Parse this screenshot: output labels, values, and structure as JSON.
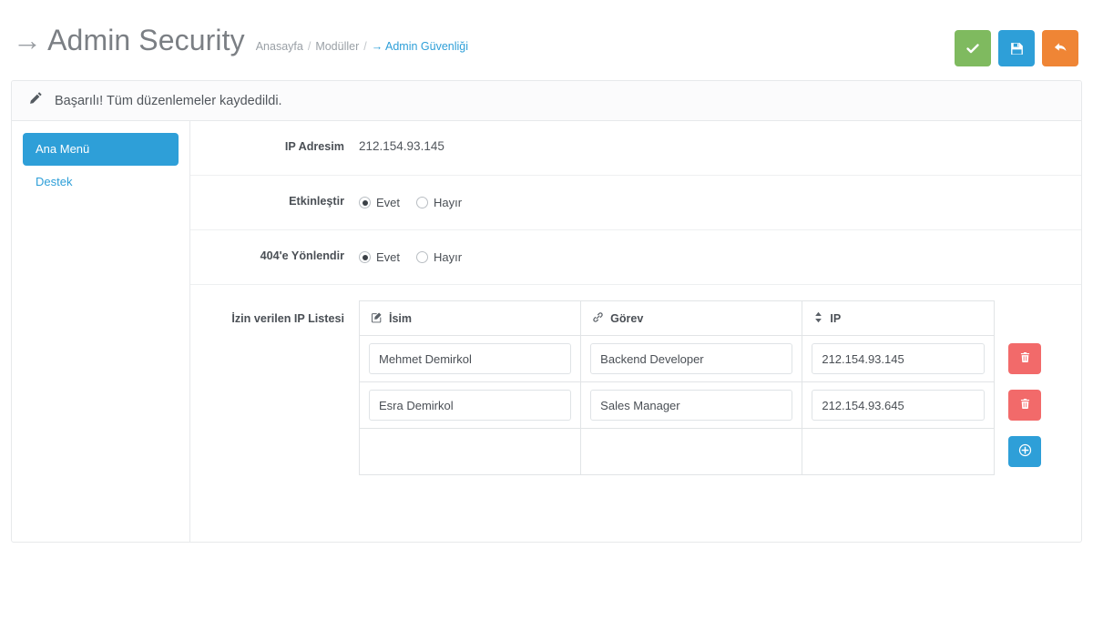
{
  "header": {
    "arrow_glyph": "→",
    "title": "Admin Security",
    "breadcrumb": {
      "home": "Anasayfa",
      "section": "Modüller",
      "current": "→ Admin Güvenliği",
      "separator": "/"
    },
    "actions": [
      {
        "name": "approve-button",
        "icon": "check-icon",
        "color": "#7fba5f"
      },
      {
        "name": "save-button",
        "icon": "floppy-disk-icon",
        "color": "#2e9fd8"
      },
      {
        "name": "back-button",
        "icon": "undo-arrow-icon",
        "color": "#ef8535"
      }
    ]
  },
  "alert": {
    "icon": "pencil-icon",
    "message": "Başarılı! Tüm düzenlemeler kaydedildi."
  },
  "sidebar": {
    "items": [
      {
        "label": "Ana Menü",
        "active": true
      },
      {
        "label": "Destek",
        "active": false
      }
    ]
  },
  "form": {
    "ip_address": {
      "label": "IP Adresim",
      "value": "212.154.93.145"
    },
    "enable": {
      "label": "Etkinleştir",
      "options": [
        {
          "label": "Evet",
          "checked": true
        },
        {
          "label": "Hayır",
          "checked": false
        }
      ]
    },
    "redirect_404": {
      "label": "404'e Yönlendir",
      "options": [
        {
          "label": "Evet",
          "checked": true
        },
        {
          "label": "Hayır",
          "checked": false
        }
      ]
    },
    "ip_list": {
      "label": "İzin verilen IP Listesi",
      "columns": [
        {
          "label": "İsim",
          "icon": "pencil-square-icon"
        },
        {
          "label": "Görev",
          "icon": "link-icon"
        },
        {
          "label": "IP",
          "icon": "sort-icon"
        },
        {
          "label": "",
          "icon": ""
        }
      ],
      "rows": [
        {
          "name": "Mehmet Demirkol",
          "role": "Backend Developer",
          "ip": "212.154.93.145",
          "delete_icon": "trash-icon"
        },
        {
          "name": "Esra Demirkol",
          "role": "Sales Manager",
          "ip": "212.154.93.645",
          "delete_icon": "trash-icon"
        }
      ],
      "add_icon": "plus-circle-icon"
    }
  },
  "colors": {
    "accent_blue": "#2e9fd8",
    "success_green": "#7fba5f",
    "warning_orange": "#ef8535",
    "danger_red": "#f26a6a"
  }
}
